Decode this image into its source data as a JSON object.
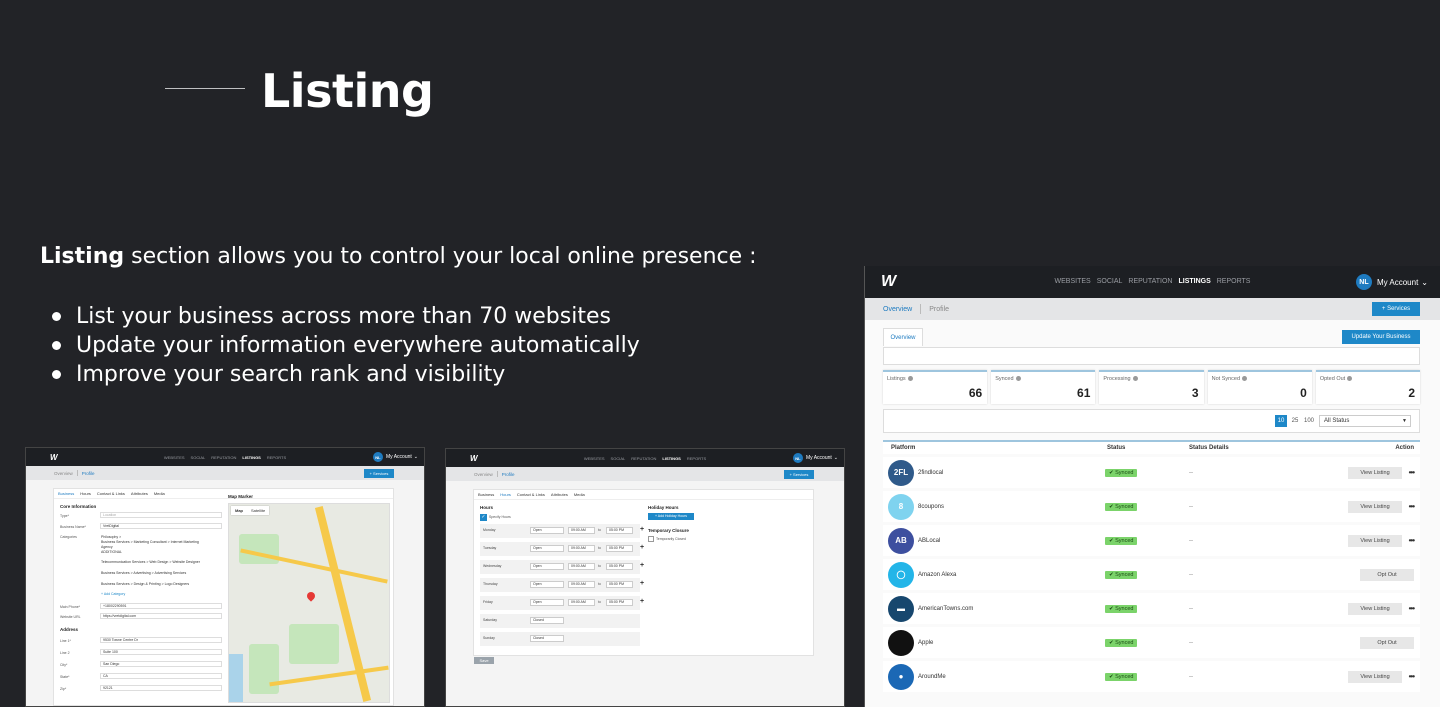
{
  "slide": {
    "title": "Listing",
    "intro_bold": "Listing",
    "intro_rest": " section allows you to control your local online presence :",
    "bullets": [
      "List your business across more than 70 websites",
      "Update your information everywhere automatically",
      "Improve your search rank and visibility"
    ]
  },
  "app": {
    "logo": "W",
    "nav": [
      "WEBSITES",
      "SOCIAL",
      "REPUTATION",
      "LISTINGS",
      "REPORTS"
    ],
    "active_nav": "LISTINGS",
    "avatar": "NL",
    "account_label": "My Account",
    "chevron": "⌄",
    "subnav_overview": "Overview",
    "subnav_profile": "Profile",
    "services_button": "+ Services"
  },
  "listing_overview": {
    "tab_overview": "Overview",
    "update_button": "Update Your Business",
    "stats": [
      {
        "label": "Listings",
        "value": "66"
      },
      {
        "label": "Synced",
        "value": "61"
      },
      {
        "label": "Processing",
        "value": "3"
      },
      {
        "label": "Not Synced",
        "value": "0"
      },
      {
        "label": "Opted Out",
        "value": "2"
      }
    ],
    "page_sizes": [
      "10",
      "25",
      "100"
    ],
    "active_page_size": "10",
    "status_filter": "All Status",
    "columns": {
      "platform": "Platform",
      "status": "Status",
      "details": "Status Details",
      "action": "Action"
    },
    "rows": [
      {
        "name": "2findlocal",
        "icon_text": "2FL",
        "icon_color": "#2f5a8a",
        "status": "✔ Synced",
        "details": "--",
        "action": "View Listing",
        "more": "•••"
      },
      {
        "name": "8coupons",
        "icon_text": "8",
        "icon_color": "#7fd3ef",
        "status": "✔ Synced",
        "details": "--",
        "action": "View Listing",
        "more": "•••"
      },
      {
        "name": "ABLocal",
        "icon_text": "AB",
        "icon_color": "#3d4f9f",
        "status": "✔ Synced",
        "details": "--",
        "action": "View Listing",
        "more": "•••"
      },
      {
        "name": "Amazon Alexa",
        "icon_text": "◯",
        "icon_color": "#23b5e8",
        "status": "✔ Synced",
        "details": "--",
        "action": "Opt Out",
        "more": ""
      },
      {
        "name": "AmericanTowns.com",
        "icon_text": "▬",
        "icon_color": "#17476e",
        "status": "✔ Synced",
        "details": "--",
        "action": "View Listing",
        "more": "•••"
      },
      {
        "name": "Apple",
        "icon_text": "",
        "icon_color": "#111111",
        "status": "✔ Synced",
        "details": "--",
        "action": "Opt Out",
        "more": ""
      },
      {
        "name": "AroundMe",
        "icon_text": "●",
        "icon_color": "#1b68b5",
        "status": "✔ Synced",
        "details": "--",
        "action": "View Listing",
        "more": "•••"
      }
    ]
  },
  "profile_business": {
    "tabs": [
      "Business",
      "Hours",
      "Contact & Links",
      "Attributes",
      "Media"
    ],
    "active_tab": "Business",
    "core_info": "Core Information",
    "fields": [
      {
        "label": "Type*",
        "value": "Location"
      },
      {
        "label": "Business Name*",
        "value": "VretDigital"
      },
      {
        "label": "Categories",
        "value": "Philosophy >"
      }
    ],
    "categories": [
      "Business Services > Marketing Consultant > Internet Marketing",
      "Agency",
      "ADDITIONAL",
      "Telecommunication Services > Web Design > Website Designer",
      "Business Services > Advertising > Advertising Services",
      "Business Services > Design & Printing > Logo Designers"
    ],
    "add_category": "+ Add Category",
    "main_phone_label": "Main Phone*",
    "main_phone": "+18002290591",
    "website_label": "Website URL",
    "website": "https://vretdigital.com",
    "address": "Address",
    "address_fields": [
      {
        "label": "Line 1*",
        "value": "9530 Towne Centre Dr"
      },
      {
        "label": "Line 2",
        "value": "Suite 100"
      },
      {
        "label": "City*",
        "value": "San Diego"
      },
      {
        "label": "State*",
        "value": "CA"
      },
      {
        "label": "Zip*",
        "value": "92121"
      }
    ],
    "map_marker": "Map Marker",
    "map_tab": "Map",
    "satellite_tab": "Satellite"
  },
  "profile_hours": {
    "tabs": [
      "Business",
      "Hours",
      "Contact & Links",
      "Attributes",
      "Media"
    ],
    "active_tab": "Hours",
    "hours_title": "Hours",
    "specify_hours": "Specify Hours",
    "days": [
      {
        "day": "Monday",
        "state": "Open",
        "from": "09:00 AM",
        "to": "05:00 PM"
      },
      {
        "day": "Tuesday",
        "state": "Open",
        "from": "09:00 AM",
        "to": "05:00 PM"
      },
      {
        "day": "Wednesday",
        "state": "Open",
        "from": "09:00 AM",
        "to": "05:00 PM"
      },
      {
        "day": "Thursday",
        "state": "Open",
        "from": "09:00 AM",
        "to": "05:00 PM"
      },
      {
        "day": "Friday",
        "state": "Open",
        "from": "09:00 AM",
        "to": "05:00 PM"
      },
      {
        "day": "Saturday",
        "state": "Closed",
        "from": "",
        "to": ""
      },
      {
        "day": "Sunday",
        "state": "Closed",
        "from": "",
        "to": ""
      }
    ],
    "to_label": "to",
    "holiday_title": "Holiday Hours",
    "add_holiday": "+ Add Holiday Hours",
    "temp_closure": "Temporary Closure",
    "temp_closed": "Temporarily Closed",
    "save": "Save"
  }
}
